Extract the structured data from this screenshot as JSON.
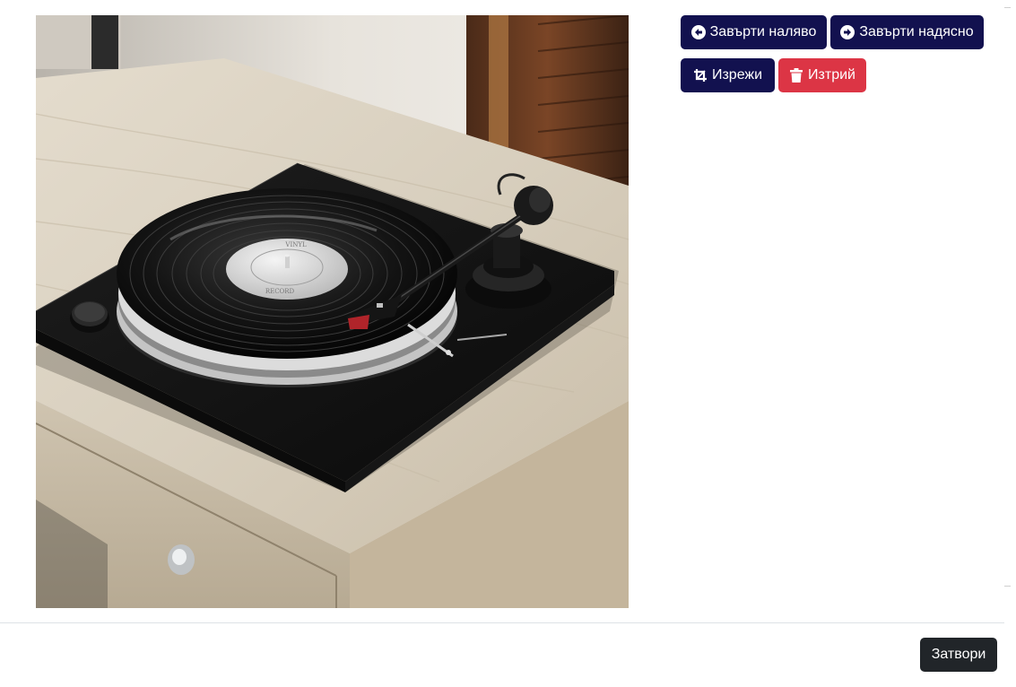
{
  "modal": {
    "image": {
      "alt": "Black turntable with vinyl record on a light wooden cabinet",
      "label_top": "VINYL",
      "label_bottom": "RECORD"
    },
    "toolbar": {
      "rotate_left_label": "Завърти наляво",
      "rotate_right_label": "Завърти надясно",
      "crop_label": "Изрежи",
      "delete_label": "Изтрий"
    },
    "footer": {
      "close_label": "Затвори"
    }
  },
  "colors": {
    "primary": "#12114f",
    "danger": "#dc3545",
    "dark": "#212529"
  },
  "icons": {
    "rotate_left": "arrow-circle-left-icon",
    "rotate_right": "arrow-circle-right-icon",
    "crop": "crop-icon",
    "delete": "trash-icon"
  }
}
